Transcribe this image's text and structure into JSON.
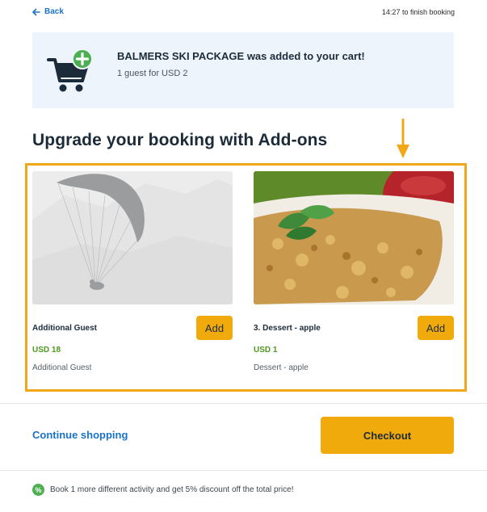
{
  "topbar": {
    "back_label": "Back",
    "timer_text": "14:27 to finish booking"
  },
  "cart_banner": {
    "title": "BALMERS SKI PACKAGE was added to your cart!",
    "subtitle": "1 guest for USD 2",
    "icon": "cart-plus-icon"
  },
  "section": {
    "title": "Upgrade your booking with Add-ons"
  },
  "addons": [
    {
      "name": "Additional Guest",
      "price": "USD 18",
      "description": "Additional Guest",
      "add_label": "Add",
      "image": "paraglider-image"
    },
    {
      "name": "3. Dessert - apple",
      "price": "USD 1",
      "description": "Dessert - apple",
      "add_label": "Add",
      "image": "apple-crumble-image"
    }
  ],
  "footer": {
    "continue_label": "Continue shopping",
    "checkout_label": "Checkout"
  },
  "promo": {
    "icon_text": "%",
    "text": "Book 1 more different activity and get 5% discount off the total price!"
  },
  "colors": {
    "accent": "#f1aa0b",
    "link": "#1a73c9",
    "price": "#4c9a1e",
    "banner_bg": "#eef4fc",
    "highlight": "#f0a818"
  }
}
